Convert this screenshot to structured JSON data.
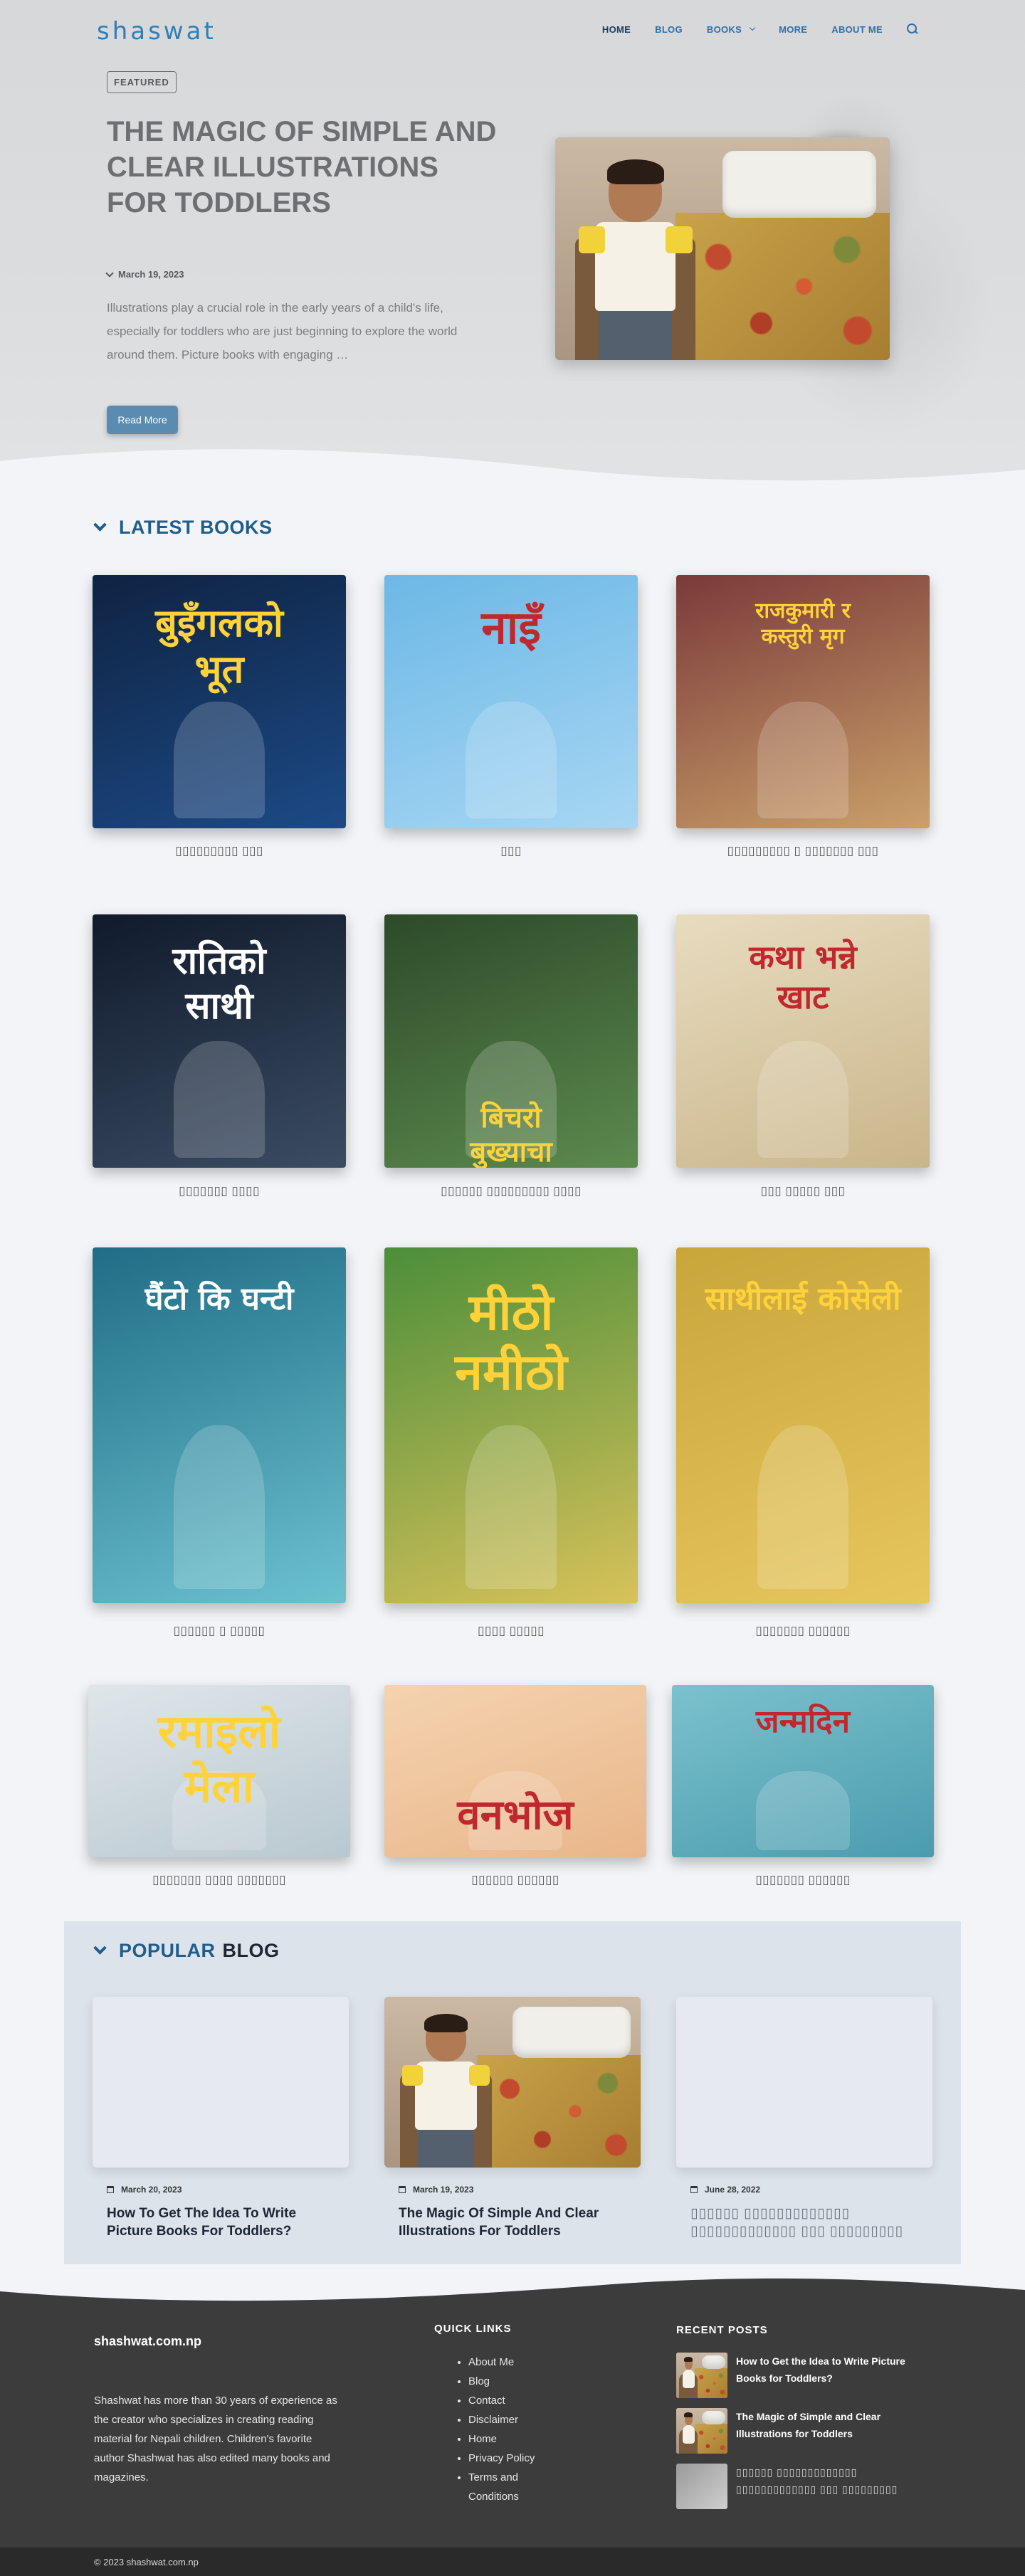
{
  "site": {
    "logo": "shaswat",
    "domain": "shashwat.com.np"
  },
  "nav": {
    "items": [
      {
        "label": "HOME",
        "color": "#1b3f63"
      },
      {
        "label": "BLOG",
        "color": "#2f6fa8"
      },
      {
        "label": "BOOKS",
        "color": "#2f6fa8",
        "has_dropdown": true
      },
      {
        "label": "MORE",
        "color": "#2f6fa8"
      },
      {
        "label": "ABOUT ME",
        "color": "#2f6fa8"
      }
    ],
    "search_icon": "search-icon"
  },
  "hero": {
    "badge": "FEATURED",
    "title": "THE MAGIC OF SIMPLE AND CLEAR ILLUSTRATIONS FOR TODDLERS",
    "date": "March 19, 2023",
    "excerpt": "Illustrations play a crucial role in the early years of a child's life, especially for toddlers who are just beginning to explore the world around them. Picture books with engaging …",
    "button": "Read More"
  },
  "latest": {
    "heading": "LATEST BOOKS",
    "books": [
      {
        "title": "▯▯▯▯▯▯▯▯▯ ▯▯▯",
        "cover_text": [
          "बुइँगलको",
          "भूत"
        ],
        "palette": [
          "#0f2342",
          "#1c4a86"
        ]
      },
      {
        "title": "▯▯▯",
        "cover_text": [
          "नाइँ"
        ],
        "palette": [
          "#6cb8e6",
          "#a7d6f3"
        ]
      },
      {
        "title": "▯▯▯▯▯▯▯▯▯ ▯ ▯▯▯▯▯▯▯ ▯▯▯",
        "cover_text": [
          "राजकुमारी र",
          "कस्तुरी मृग"
        ],
        "palette": [
          "#7a3a3a",
          "#caa06a"
        ]
      },
      {
        "title": "▯▯▯▯▯▯▯ ▯▯▯▯",
        "cover_text": [
          "रातिको",
          "साथी"
        ],
        "palette": [
          "#101a2b",
          "#3b4c63"
        ]
      },
      {
        "title": "▯▯▯▯▯▯ ▯▯▯▯▯▯▯▯▯ ▯▯▯▯",
        "cover_text": [
          "बिचरो",
          "बुख्याचा"
        ],
        "palette": [
          "#2d4a2a",
          "#5c8a4e"
        ]
      },
      {
        "title": "▯▯▯ ▯▯▯▯▯ ▯▯▯",
        "cover_text": [
          "कथा भन्ने",
          "खाट"
        ],
        "palette": [
          "#e8dcc0",
          "#c9b58a"
        ]
      },
      {
        "title": "▯▯▯▯▯▯ ▯ ▯▯▯▯▯",
        "cover_text": [
          "घैंटो कि घन्टी"
        ],
        "palette": [
          "#1f6d86",
          "#6cc1cf"
        ]
      },
      {
        "title": "▯▯▯▯ ▯▯▯▯▯",
        "cover_text": [
          "मीठो",
          "नमीठो"
        ],
        "palette": [
          "#4c8e3a",
          "#d7c25a"
        ]
      },
      {
        "title": "▯▯▯▯▯▯▯ ▯▯▯▯▯▯",
        "cover_text": [
          "साथीलाई कोसेली"
        ],
        "palette": [
          "#c9a63a",
          "#e7c65e"
        ]
      },
      {
        "title": "▯▯▯▯▯▯▯ ▯▯▯▯ ▯▯▯▯▯▯▯",
        "cover_text": [
          "रमाइलो",
          "मेला"
        ],
        "palette": [
          "#dfe6ea",
          "#b9c8d0"
        ]
      },
      {
        "title": "▯▯▯▯▯▯ ▯▯▯▯▯▯",
        "cover_text": [
          "वनभोज"
        ],
        "palette": [
          "#f4d3b0",
          "#e9b68a"
        ]
      },
      {
        "title": "▯▯▯▯▯▯▯ ▯▯▯▯▯▯",
        "cover_text": [
          "जन्मदिन"
        ],
        "palette": [
          "#7cc1cd",
          "#4a9cae"
        ]
      }
    ]
  },
  "popular": {
    "heading_1": "POPULAR",
    "heading_2": "BLOG",
    "posts": [
      {
        "date": "March 20, 2023",
        "title": "How To Get The Idea To Write Picture Books For Toddlers?",
        "has_image": false
      },
      {
        "date": "March 19, 2023",
        "title": "The Magic Of Simple And Clear Illustrations For Toddlers",
        "has_image": true
      },
      {
        "date": "June 28, 2022",
        "title": "▯▯▯▯▯▯ ▯▯▯▯▯▯▯▯▯▯▯▯▯ ▯▯▯▯▯▯▯▯▯▯▯▯▯ ▯▯▯ ▯▯▯▯▯▯▯▯▯",
        "has_image": false,
        "muted": true
      }
    ]
  },
  "footer": {
    "site_title": "shashwat.com.np",
    "about": "Shashwat has more than 30 years of experience as the creator who specializes in creating reading material for Nepali children. Children's favorite author Shashwat has also edited many books and magazines.",
    "quick_links_heading": "QUICK LINKS",
    "quick_links": [
      "About Me",
      "Blog",
      "Contact",
      "Disclaimer",
      "Home",
      "Privacy Policy",
      "Terms and Conditions"
    ],
    "recent_heading": "RECENT POSTS",
    "recent_posts": [
      {
        "title": "How to Get the Idea to Write Picture Books for Toddlers?"
      },
      {
        "title": "The Magic of Simple and Clear Illustrations for Toddlers"
      },
      {
        "title": "▯▯▯▯▯▯ ▯▯▯▯▯▯▯▯▯▯▯▯▯ ▯▯▯▯▯▯▯▯▯▯▯▯▯ ▯▯▯ ▯▯▯▯▯▯▯▯▯",
        "muted": true
      }
    ],
    "copyright": "© 2023 shashwat.com.np",
    "bg_color": "#3c3c3c"
  }
}
